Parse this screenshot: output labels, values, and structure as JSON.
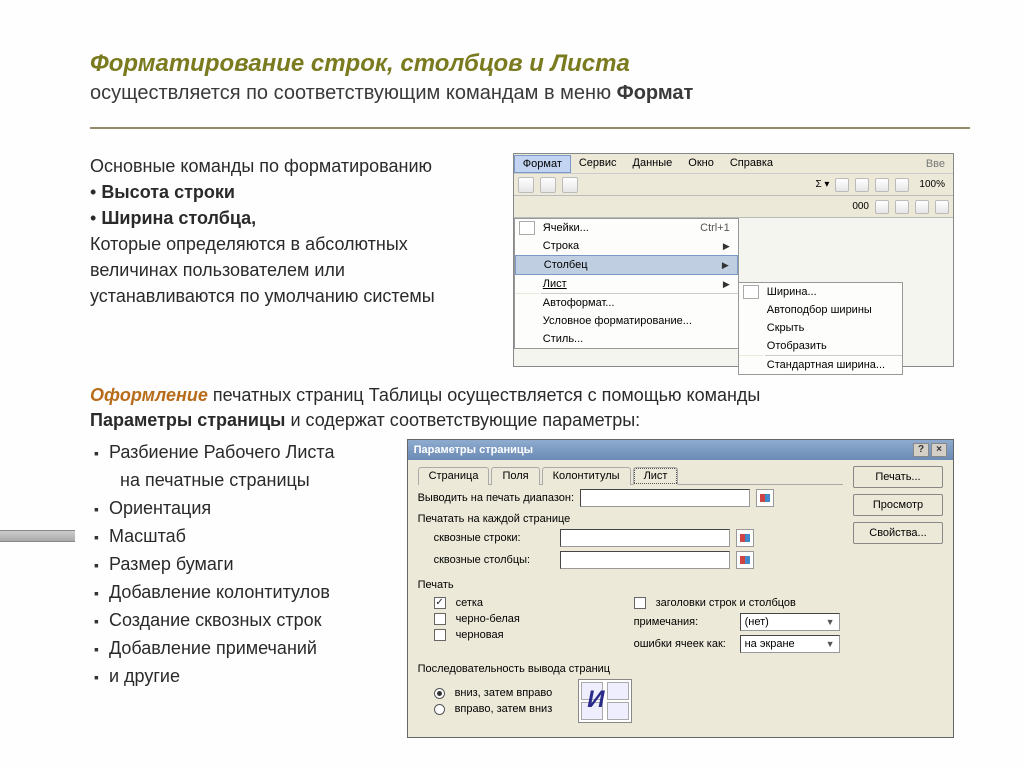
{
  "title": "Форматирование строк, столбцов и Листа",
  "subtitle_prefix": "осуществляется   по соответствующим  командам в меню ",
  "subtitle_bold": "Формат",
  "block1": {
    "line1": "Основные команды по форматированию",
    "b1": "Высота строки",
    "b2": "Ширина столбца,",
    "line4": "Которые определяются в абсолютных величинах пользователем или устанавливаются по умолчанию системы"
  },
  "menubar": [
    "Формат",
    "Сервис",
    "Данные",
    "Окно",
    "Справка"
  ],
  "menubar_right": "Вве",
  "zoom": "100%",
  "dd1": [
    {
      "label": "Ячейки...",
      "kb": "Ctrl+1"
    },
    {
      "label": "Строка",
      "sub": true
    },
    {
      "label": "Столбец",
      "sub": true,
      "sel": true
    },
    {
      "label": "Лист",
      "sub": true
    },
    {
      "label": "Автоформат..."
    },
    {
      "label": "Условное форматирование..."
    },
    {
      "label": "Стиль..."
    }
  ],
  "dd2": [
    "Ширина...",
    "Автоподбор ширины",
    "Скрыть",
    "Отобразить",
    "Стандартная ширина..."
  ],
  "para2": {
    "orange": "Оформление",
    "text1": "  печатных страниц Таблицы осуществляется с помощью команды ",
    "bold1": "Параметры страницы",
    "text2": " и содержат соответствующие параметры:"
  },
  "list2": [
    "Разбиение Рабочего Листа",
    "на печатные страницы",
    "Ориентация",
    "Масштаб",
    "Размер бумаги",
    "Добавление колонтитулов",
    "Создание сквозных строк",
    "Добавление примечаний",
    "и другие"
  ],
  "dialog": {
    "title": "Параметры страницы",
    "tabs": [
      "Страница",
      "Поля",
      "Колонтитулы",
      "Лист"
    ],
    "active_tab": 3,
    "btns": [
      "Печать...",
      "Просмотр",
      "Свойства..."
    ],
    "range_label": "Выводить на печать диапазон:",
    "range_value": "",
    "each_page": "Печатать на каждой странице",
    "through_rows": "сквозные строки:",
    "through_cols": "сквозные столбцы:",
    "print_label": "Печать",
    "chk_grid": "сетка",
    "chk_bw": "черно-белая",
    "chk_draft": "черновая",
    "chk_headers": "заголовки строк и столбцов",
    "notes_label": "примечания:",
    "notes_value": "(нет)",
    "errors_label": "ошибки ячеек как:",
    "errors_value": "на экране",
    "order_label": "Последовательность вывода страниц",
    "radio1": "вниз, затем вправо",
    "radio2": "вправо, затем вниз"
  }
}
